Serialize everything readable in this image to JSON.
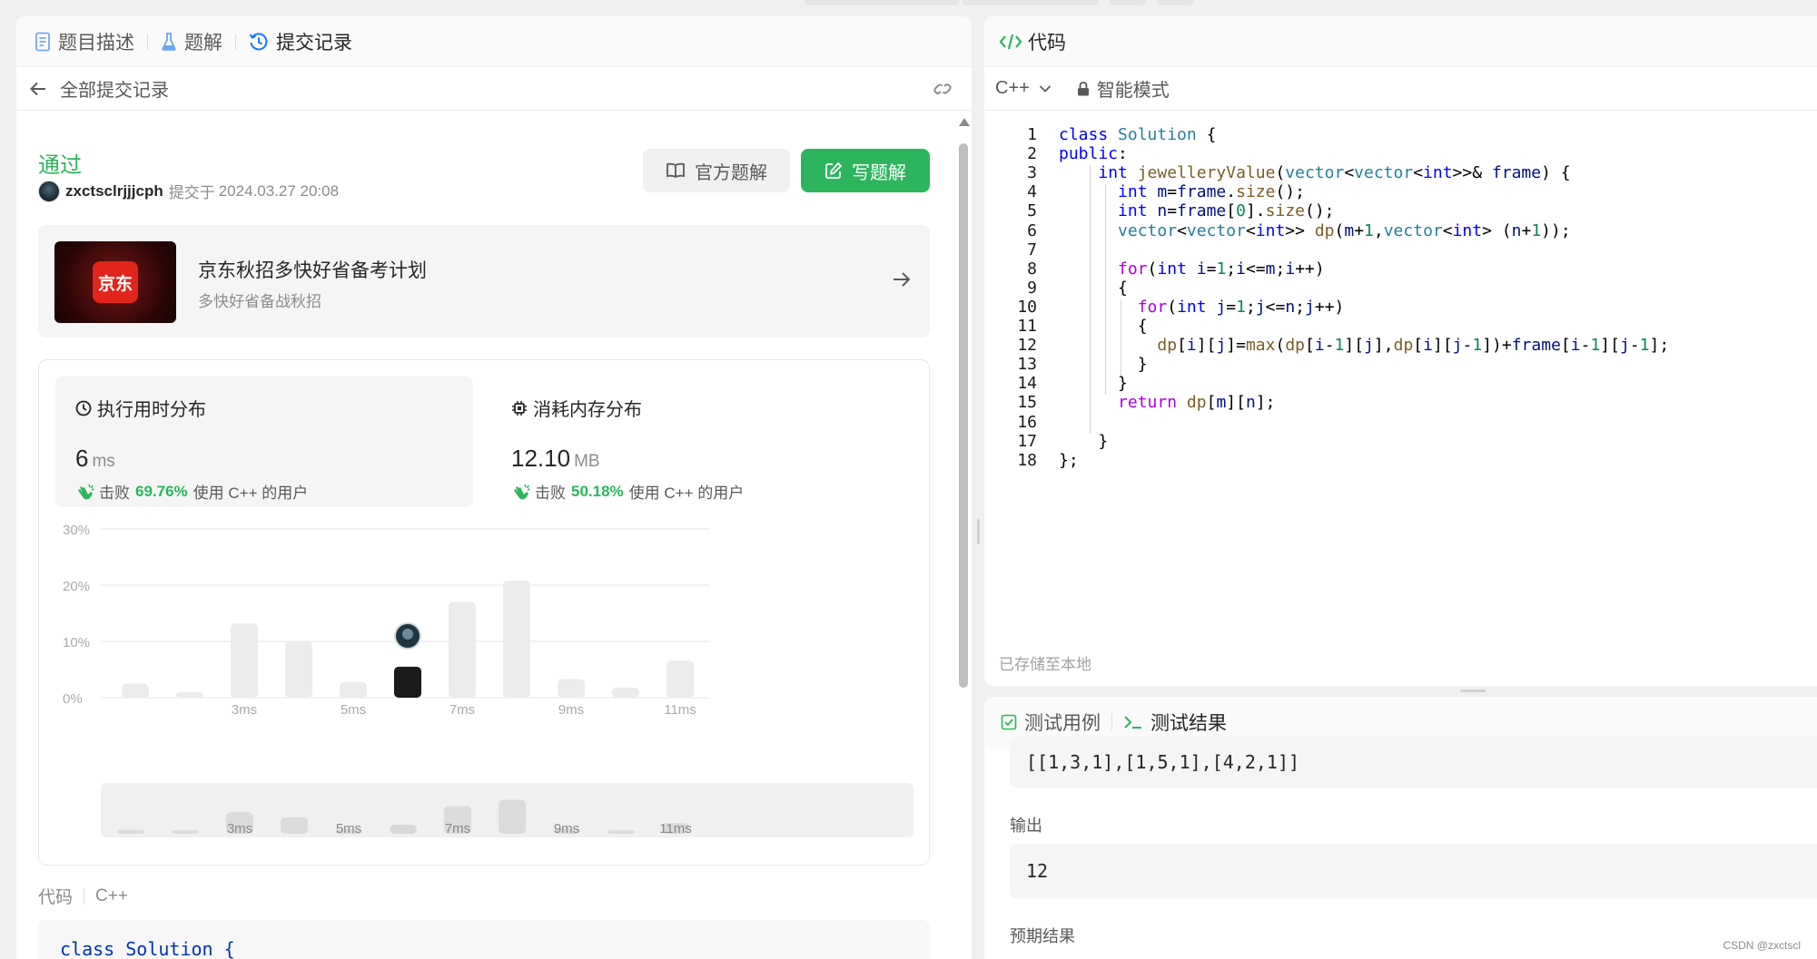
{
  "tabs": [
    {
      "label": "题目描述",
      "icon": "document-icon"
    },
    {
      "label": "题解",
      "icon": "flask-icon"
    },
    {
      "label": "提交记录",
      "icon": "history-icon",
      "active": true
    }
  ],
  "subheader": {
    "title": "全部提交记录"
  },
  "submission": {
    "status": "通过",
    "author": "zxctsclrjjjcph",
    "submitted_prefix": "提交于",
    "submitted_at": "2024.03.27 20:08"
  },
  "buttons": {
    "official_solution": "官方题解",
    "write_solution": "写题解"
  },
  "ad": {
    "title": "京东秋招多快好省备考计划",
    "subtitle": "多快好省备战秋招",
    "logo_text": "京东"
  },
  "runtime": {
    "title": "执行用时分布",
    "value": "6",
    "unit": "ms",
    "beat_prefix": "击败",
    "beat_pct": "69.76%",
    "beat_suffix": "使用 C++ 的用户"
  },
  "memory": {
    "title": "消耗内存分布",
    "value": "12.10",
    "unit": "MB",
    "beat_prefix": "击败",
    "beat_pct": "50.18%",
    "beat_suffix": "使用 C++ 的用户"
  },
  "chart_data": {
    "type": "bar",
    "y_ticks": [
      "30%",
      "20%",
      "10%",
      "0%"
    ],
    "ylim": [
      0,
      30
    ],
    "x_tick_labels": [
      "3ms",
      "5ms",
      "7ms",
      "9ms",
      "11ms"
    ],
    "values": [
      2.5,
      1.0,
      13.2,
      10.0,
      2.8,
      5.5,
      17.0,
      20.8,
      3.3,
      1.8,
      6.6
    ],
    "highlight_index": 5,
    "highlight_color": "#1a1a1a",
    "bar_color": "#ebebeb"
  },
  "code_section": {
    "label": "代码",
    "lang": "C++",
    "preview_line": "class Solution {"
  },
  "editor": {
    "title": "代码",
    "language": "C++",
    "mode": "智能模式",
    "saved_note": "已存储至本地",
    "lines": [
      "class Solution {",
      "public:",
      "    int jewelleryValue(vector<vector<int>>& frame) {",
      "      int m=frame.size();",
      "      int n=frame[0].size();",
      "      vector<vector<int>> dp(m+1,vector<int> (n+1));",
      "",
      "      for(int i=1;i<=m;i++)",
      "      {",
      "        for(int j=1;j<=n;j++)",
      "        {",
      "          dp[i][j]=max(dp[i-1][j],dp[i][j-1])+frame[i-1][j-1];",
      "        }",
      "      }",
      "      return dp[m][n];",
      "",
      "    }",
      "};"
    ]
  },
  "test_panel": {
    "tab_cases": "测试用例",
    "tab_results": "测试结果",
    "input_value": "[[1,3,1],[1,5,1],[4,2,1]]",
    "output_label": "输出",
    "output_value": "12",
    "expected_label": "预期结果"
  },
  "watermark": "CSDN @zxctscl",
  "colors": {
    "accent_green": "#2db55d",
    "link_blue": "#1677ff"
  }
}
